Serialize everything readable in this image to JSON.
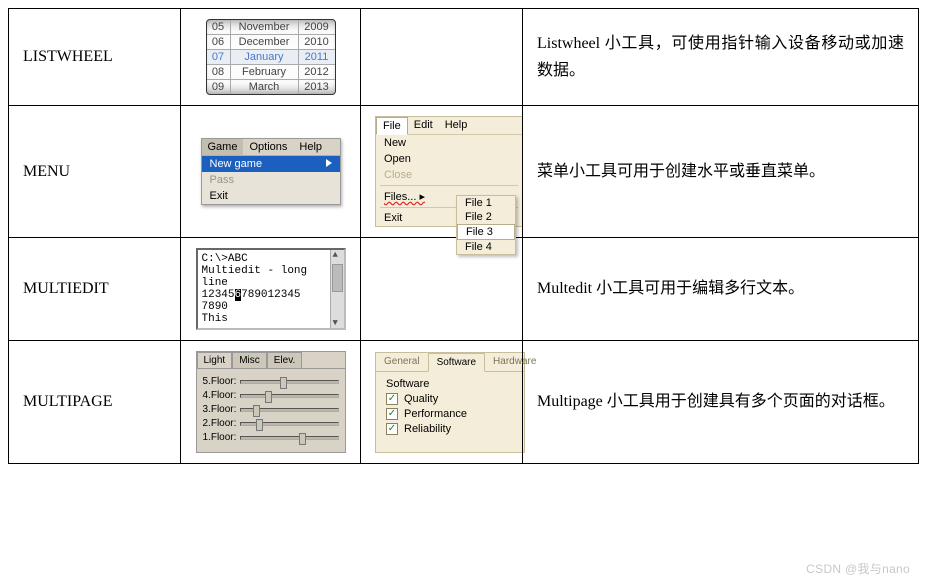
{
  "rows": [
    {
      "name": "LISTWHEEL",
      "desc": "Listwheel 小工具，可使用指针输入设备移动或加速数据。"
    },
    {
      "name": "MENU",
      "desc": "菜单小工具可用于创建水平或垂直菜单。"
    },
    {
      "name": "MULTIEDIT",
      "desc": "Multedit 小工具可用于编辑多行文本。"
    },
    {
      "name": "MULTIPAGE",
      "desc": "Multipage 小工具用于创建具有多个页面的对话框。"
    }
  ],
  "listwheel": {
    "cols": [
      [
        "05",
        "06",
        "07",
        "08",
        "09"
      ],
      [
        "November",
        "December",
        "January",
        "February",
        "March"
      ],
      [
        "2009",
        "2010",
        "2011",
        "2012",
        "2013"
      ]
    ],
    "selected_index": 2
  },
  "menu1": {
    "bar": [
      "Game",
      "Options",
      "Help"
    ],
    "bar_selected": 0,
    "items": [
      {
        "label": "New game",
        "state": "sel"
      },
      {
        "label": "Pass",
        "state": "dis"
      },
      {
        "label": "Exit",
        "state": ""
      }
    ]
  },
  "menu2": {
    "bar": [
      "File",
      "Edit",
      "Help"
    ],
    "bar_selected": 0,
    "items": [
      "New",
      "Open",
      "Close",
      "---",
      "Files... ▸",
      "---",
      "Exit"
    ],
    "disabled": [
      "Close"
    ],
    "submenu": [
      "File 1",
      "File 2",
      "File 3",
      "File 4"
    ],
    "submenu_selected": 2
  },
  "multiedit": {
    "lines": [
      "C:\\>ABC",
      "Multiedit - long",
      "line",
      "123456789012345",
      "7890",
      "This"
    ],
    "caret_pos": {
      "line": 3,
      "col": 5
    }
  },
  "multipage1": {
    "tabs": [
      "Light",
      "Misc",
      "Elev."
    ],
    "tab_selected": 0,
    "rows": [
      "5.Floor:",
      "4.Floor:",
      "3.Floor:",
      "2.Floor:",
      "1.Floor:"
    ],
    "knob_pct": [
      40,
      25,
      12,
      15,
      60
    ]
  },
  "multipage2": {
    "tabs": [
      "General",
      "Software",
      "Hardware"
    ],
    "tab_selected": 1,
    "heading": "Software",
    "checks": [
      {
        "label": "Quality",
        "checked": true
      },
      {
        "label": "Performance",
        "checked": true
      },
      {
        "label": "Reliability",
        "checked": true
      }
    ]
  },
  "watermark": "CSDN @我与nano"
}
